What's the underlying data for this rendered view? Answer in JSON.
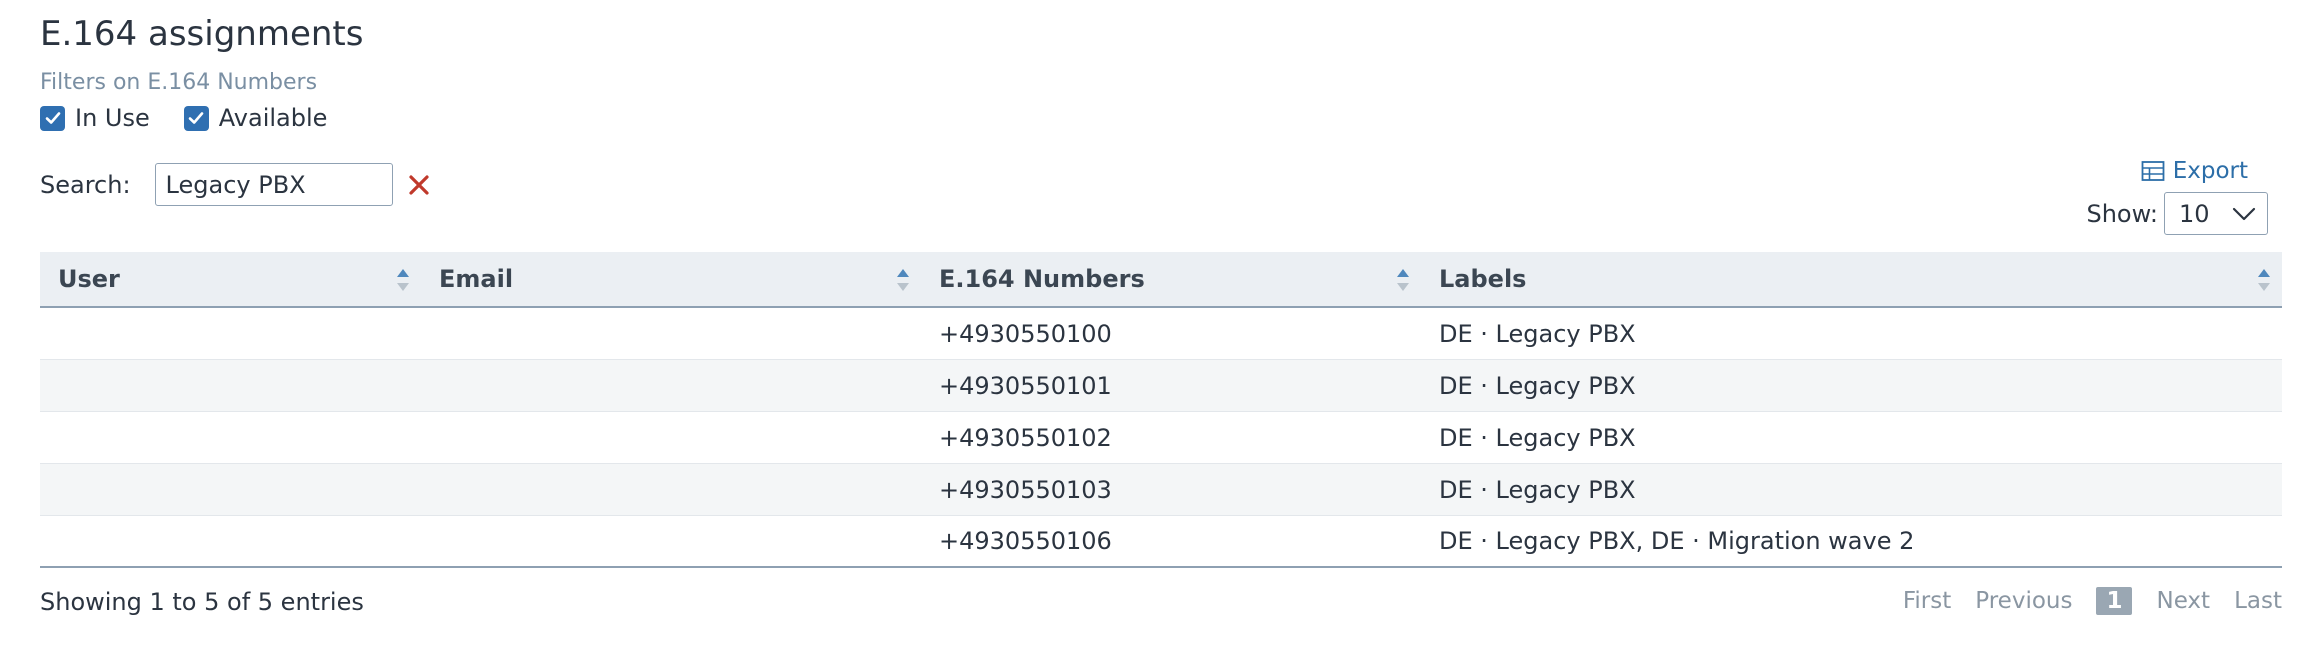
{
  "page": {
    "title": "E.164 assignments"
  },
  "filters": {
    "caption": "Filters on E.164 Numbers",
    "items": [
      {
        "label": "In Use",
        "checked": true
      },
      {
        "label": "Available",
        "checked": true
      }
    ]
  },
  "search": {
    "label": "Search:",
    "value": "Legacy PBX"
  },
  "toolbar": {
    "export_label": "Export",
    "show_label": "Show:",
    "page_size": "10"
  },
  "table": {
    "columns": [
      "User",
      "Email",
      "E.164 Numbers",
      "Labels"
    ],
    "rows": [
      {
        "user": "",
        "email": "",
        "number": "+4930550100",
        "labels": "DE · Legacy PBX"
      },
      {
        "user": "",
        "email": "",
        "number": "+4930550101",
        "labels": "DE · Legacy PBX"
      },
      {
        "user": "",
        "email": "",
        "number": "+4930550102",
        "labels": "DE · Legacy PBX"
      },
      {
        "user": "",
        "email": "",
        "number": "+4930550103",
        "labels": "DE · Legacy PBX"
      },
      {
        "user": "",
        "email": "",
        "number": "+4930550106",
        "labels": "DE · Legacy PBX, DE · Migration wave 2"
      }
    ]
  },
  "footer": {
    "info": "Showing 1 to 5 of 5 entries",
    "pager": {
      "first": "First",
      "previous": "Previous",
      "current": "1",
      "next": "Next",
      "last": "Last"
    }
  },
  "colors": {
    "accent": "#2f6fb1",
    "link": "#2c6ea8",
    "clear": "#c0392b",
    "header_bg": "#ebeff3"
  }
}
